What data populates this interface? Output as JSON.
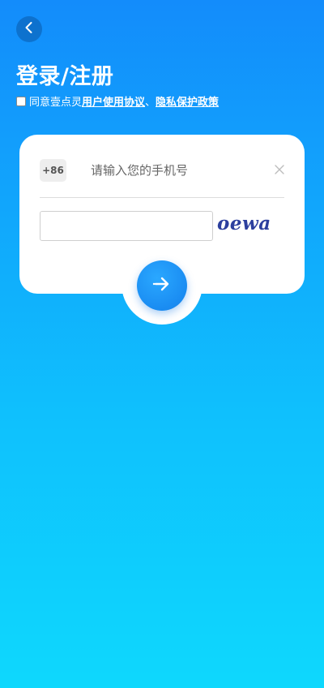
{
  "header": {
    "back_icon": "chevron-left-icon",
    "title": "登录/注册"
  },
  "agreement": {
    "prefix": "同意壹点灵",
    "user_agreement_link": "用户使用协议",
    "separator": "、",
    "privacy_policy_link": "隐私保护政策",
    "checked": false
  },
  "login_form": {
    "country_code": "+86",
    "phone_placeholder": "请输入您的手机号",
    "phone_value": "",
    "clear_icon": "close-icon",
    "captcha_value": "",
    "captcha_text": "oewa",
    "submit_icon": "arrow-right-icon"
  },
  "colors": {
    "background_top": "#138cfb",
    "background_bottom": "#0ed8fd",
    "button_blue": "#1a8cf2",
    "captcha_text": "#2c3f9e"
  }
}
